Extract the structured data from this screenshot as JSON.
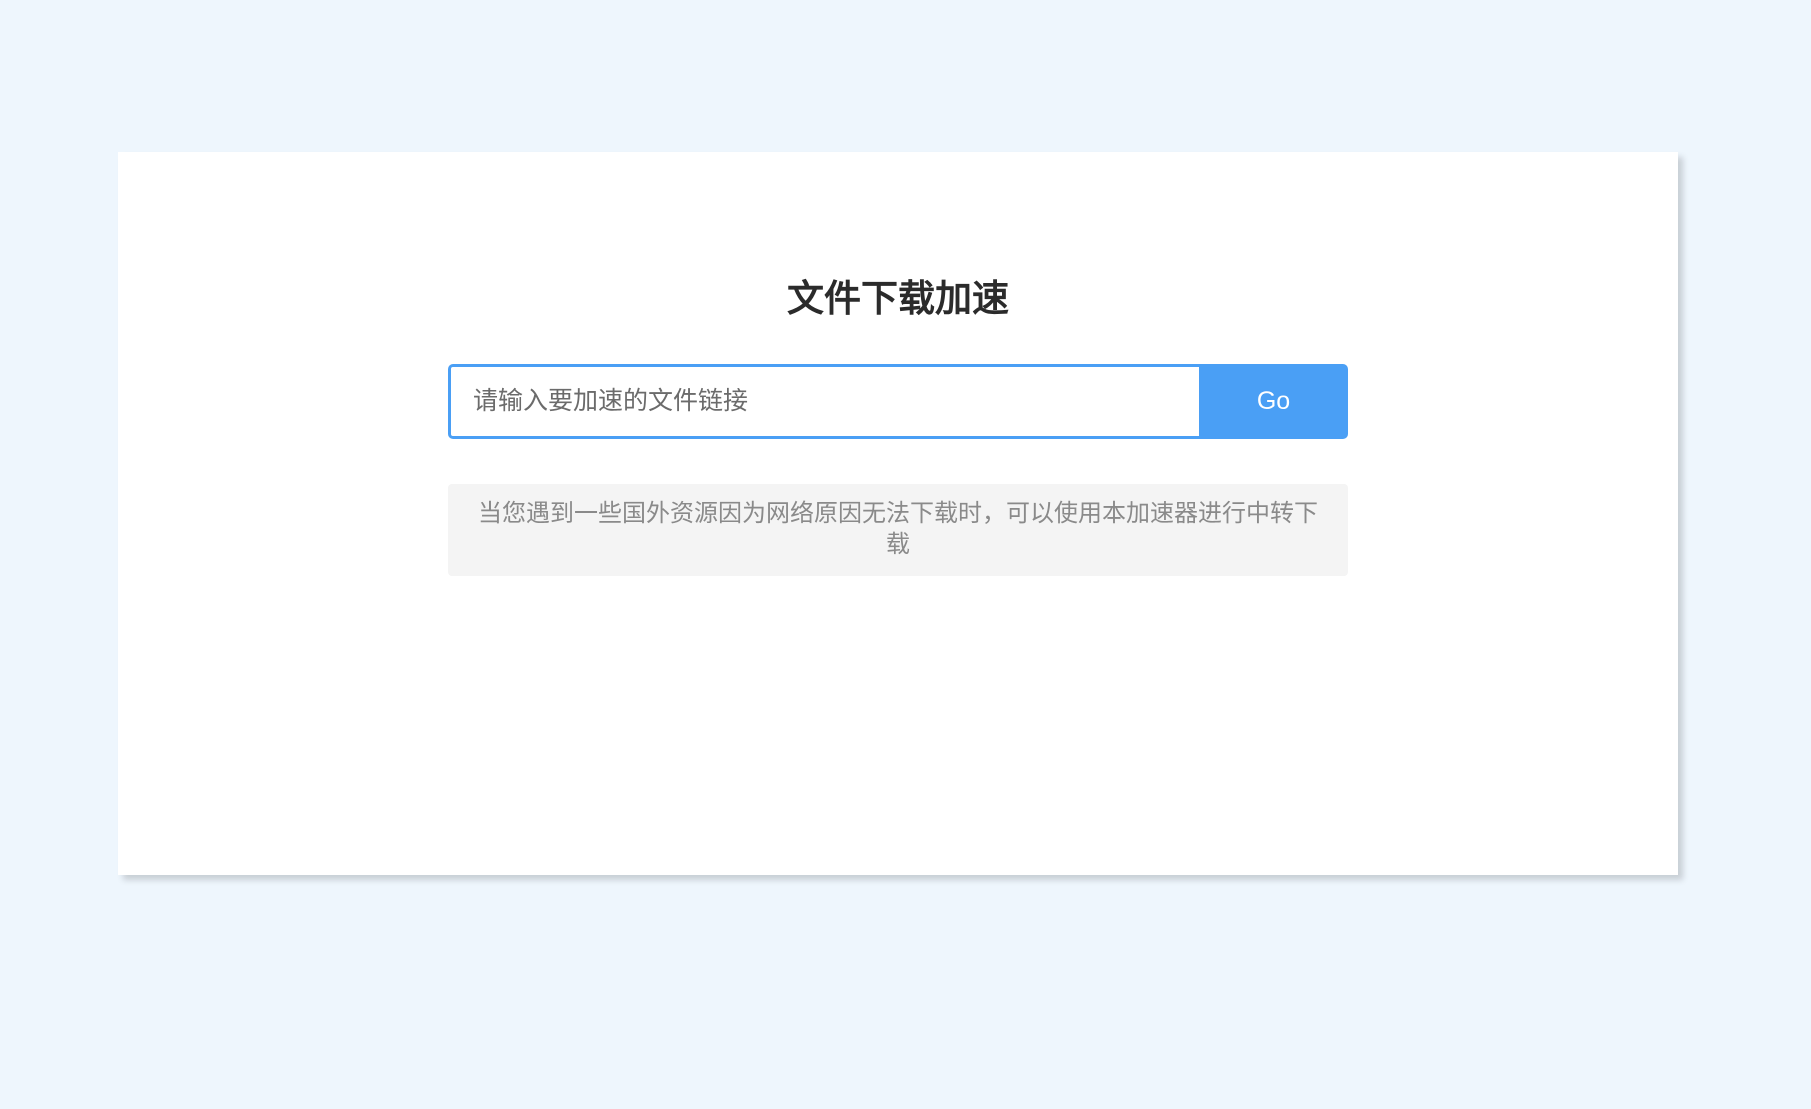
{
  "page": {
    "title": "文件下载加速"
  },
  "search": {
    "placeholder": "请输入要加速的文件链接",
    "value": "",
    "button_label": "Go"
  },
  "notice": {
    "text": "当您遇到一些国外资源因为网络原因无法下载时，可以使用本加速器进行中转下载"
  },
  "colors": {
    "background": "#eef6fd",
    "accent": "#4a9ff5",
    "card": "#ffffff",
    "notice_background": "#f4f4f4"
  }
}
